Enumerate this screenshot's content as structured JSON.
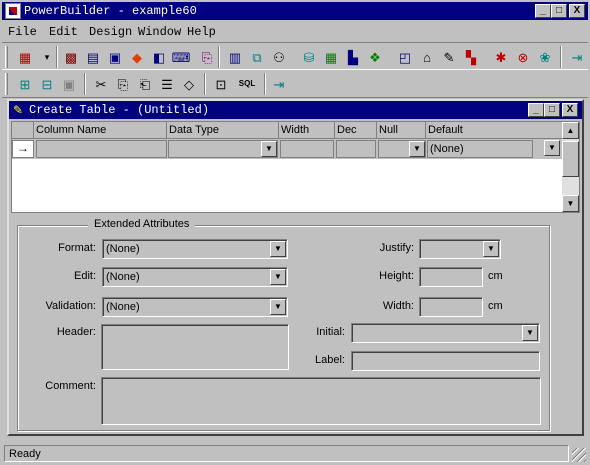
{
  "app": {
    "title": "PowerBuilder - example60"
  },
  "window_controls": {
    "minimize": "_",
    "maximize": "□",
    "close": "X"
  },
  "menu": [
    {
      "label": "File",
      "key": "F"
    },
    {
      "label": "Edit",
      "key": "E"
    },
    {
      "label": "Design",
      "key": "D"
    },
    {
      "label": "Window",
      "key": "W"
    },
    {
      "label": "Help",
      "key": "H"
    }
  ],
  "toolbar2": {
    "sql_label": "SQL"
  },
  "child_window": {
    "title": "Create Table - (Untitled)"
  },
  "grid": {
    "columns": [
      "Column Name",
      "Data Type",
      "Width",
      "Dec",
      "Null",
      "Default"
    ],
    "row": {
      "indicator": "→",
      "default_value": "(None)"
    }
  },
  "extended": {
    "group_title": "Extended Attributes",
    "format": {
      "label": "Format:",
      "value": "(None)"
    },
    "edit": {
      "label": "Edit:",
      "value": "(None)"
    },
    "validation": {
      "label": "Validation:",
      "value": "(None)"
    },
    "header": {
      "label": "Header:"
    },
    "comment": {
      "label": "Comment:"
    },
    "justify": {
      "label": "Justify:",
      "value": ""
    },
    "height": {
      "label": "Height:",
      "unit": "cm"
    },
    "width": {
      "label": "Width:",
      "unit": "cm"
    },
    "initial": {
      "label": "Initial:",
      "value": ""
    },
    "label_field": {
      "label": "Label:",
      "value": ""
    }
  },
  "status": {
    "text": "Ready"
  },
  "icons": [
    "app-icon",
    "window-icon",
    "database-icon",
    "table-icon",
    "cut-icon",
    "copy-icon",
    "paste-icon",
    "clear-icon",
    "erase-icon",
    "properties-icon",
    "exit-icon"
  ]
}
